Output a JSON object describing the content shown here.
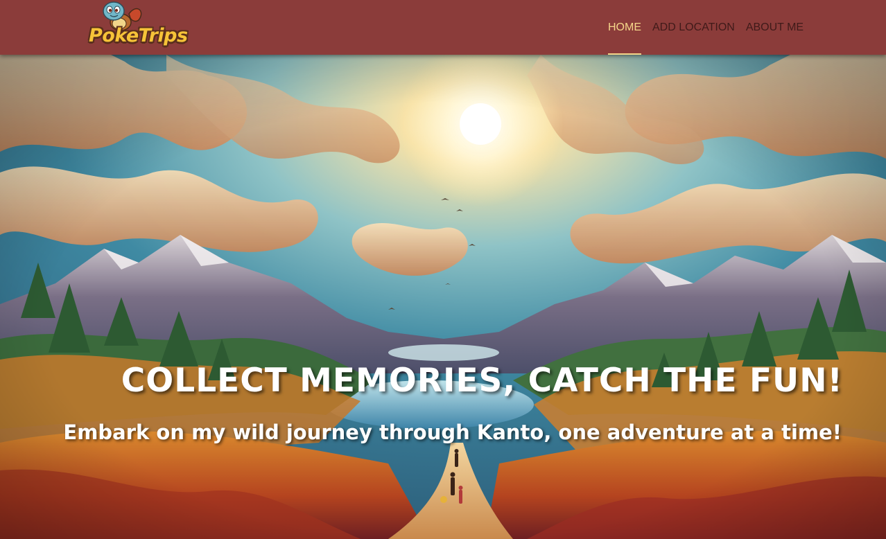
{
  "brand": {
    "logo_text": "PokeTrips",
    "logo_icon": "squirtle-mascot-icon"
  },
  "nav": {
    "items": [
      {
        "label": "HOME",
        "active": true
      },
      {
        "label": "ADD LOCATION",
        "active": false
      },
      {
        "label": "ABOUT ME",
        "active": false
      }
    ]
  },
  "hero": {
    "title": "COLLECT MEMORIES, CATCH THE FUN!",
    "subtitle": "Embark on my wild journey through Kanto, one adventure at a time!"
  },
  "colors": {
    "navbar_bg": "#8b3c3a",
    "nav_active": "#f5d68a",
    "nav_text": "#3f1a19",
    "logo_text": "#f6c338"
  }
}
